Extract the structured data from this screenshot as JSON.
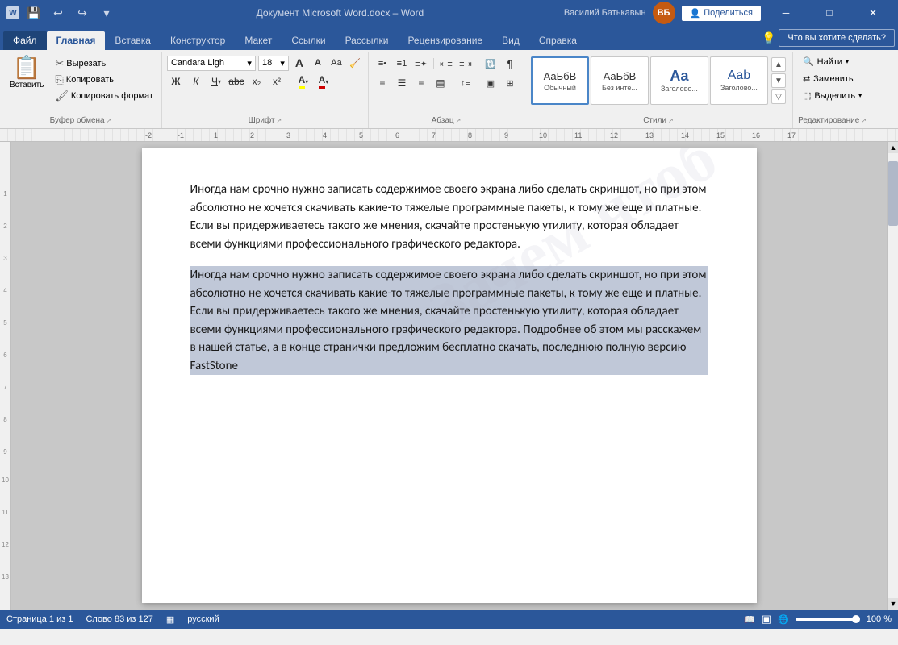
{
  "titlebar": {
    "title": "Документ Microsoft Word.docx  –  Word",
    "app": "Word",
    "user": "Василий Батькавын",
    "user_initials": "ВБ",
    "minimize": "─",
    "restore": "□",
    "close": "✕",
    "share_label": "Поделиться"
  },
  "quickaccess": {
    "save": "💾",
    "undo": "↩",
    "redo": "↪",
    "dropdown": "▾"
  },
  "tabs": [
    {
      "label": "Файл",
      "id": "file",
      "active": false
    },
    {
      "label": "Главная",
      "id": "home",
      "active": true
    },
    {
      "label": "Вставка",
      "id": "insert",
      "active": false
    },
    {
      "label": "Конструктор",
      "id": "design",
      "active": false
    },
    {
      "label": "Макет",
      "id": "layout",
      "active": false
    },
    {
      "label": "Ссылки",
      "id": "refs",
      "active": false
    },
    {
      "label": "Рассылки",
      "id": "mail",
      "active": false
    },
    {
      "label": "Рецензирование",
      "id": "review",
      "active": false
    },
    {
      "label": "Вид",
      "id": "view",
      "active": false
    },
    {
      "label": "Справка",
      "id": "help",
      "active": false
    }
  ],
  "ribbon": {
    "clipboard": {
      "label": "Буфер обмена",
      "paste": "Вставить",
      "cut": "Вырезать",
      "copy": "Копировать",
      "format_painter": "Копировать формат"
    },
    "font": {
      "label": "Шрифт",
      "family": "Candara Ligh",
      "size": "18",
      "bold": "Ж",
      "italic": "К",
      "underline": "Ч",
      "strikethrough": "аbc",
      "superscript": "х²",
      "subscript": "х₂",
      "grow": "A",
      "shrink": "A",
      "case": "Аа",
      "color": "А",
      "highlight": "А"
    },
    "paragraph": {
      "label": "Абзац"
    },
    "styles": {
      "label": "Стили",
      "items": [
        {
          "name": "Обычный",
          "preview": "АаБбВ",
          "active": true
        },
        {
          "name": "Без инте...",
          "preview": "АаБбВ"
        },
        {
          "name": "Заголово...",
          "preview": "Аа"
        },
        {
          "name": "Заголово...",
          "preview": "Аab"
        }
      ]
    },
    "editing": {
      "label": "Редактирование",
      "find": "Найти",
      "replace": "Заменить",
      "select": "Выделить"
    },
    "what": "Что вы хотите сделать?"
  },
  "document": {
    "para1": "Иногда нам срочно нужно записать содержимое своего экрана либо сделать скриншот, но при этом абсолютно не хочется скачивать какие-то тяжелые программные пакеты, к тому же еще и платные. Если вы придерживаетесь такого же мнения, скачайте простенькую утилиту, которая обладает всеми функциями профессионального графического редактора.",
    "para2": "Иногда нам срочно нужно записать содержимое своего экрана либо сделать скриншот, но при этом абсолютно не хочется скачивать какие-то тяжелые программные пакеты, к тому же еще и платные. Если вы придерживаетесь такого же мнения, скачайте простенькую утилиту, которая обладает всеми функциями профессионального графического редактора. Подробнее об этом мы расскажем в нашей статье, а в конце странички предложим бесплатно скачать, последнюю полную версию FastStone",
    "watermark": "Зачем чтоб"
  },
  "statusbar": {
    "page": "Страница 1 из 1",
    "words": "Слово 83 из 127",
    "lang": "русский",
    "zoom": "100 %",
    "layout_icon": "▦",
    "read_icon": "📖"
  }
}
